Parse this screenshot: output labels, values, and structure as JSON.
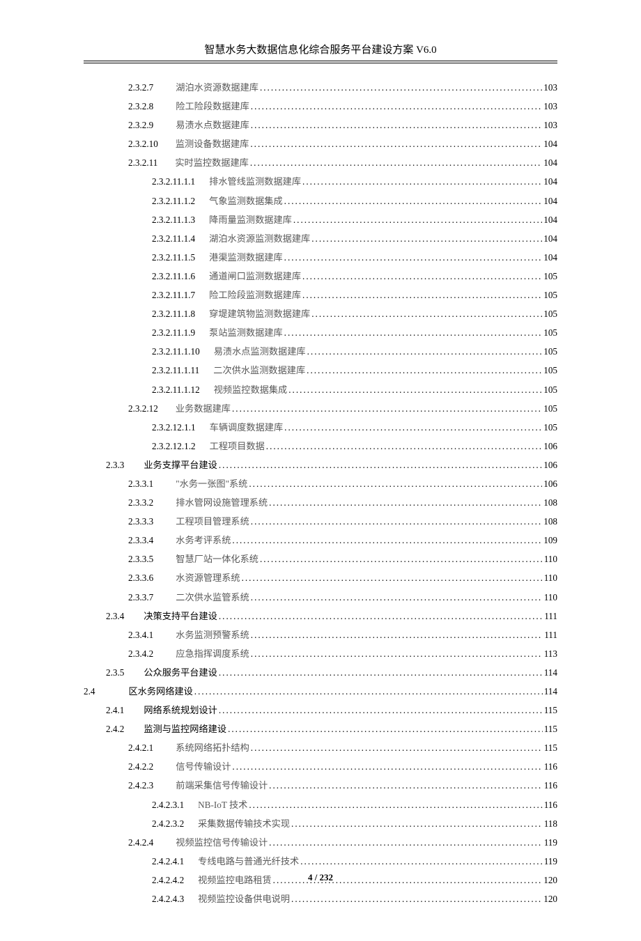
{
  "header": {
    "title": "智慧水务大数据信息化综合服务平台建设方案 V6.0"
  },
  "footer": {
    "text": "4 / 232"
  },
  "toc": [
    {
      "indent": "ind-4",
      "num": "2.3.2.7",
      "title": "湖泊水资源数据建库",
      "page": "103",
      "gap": 32
    },
    {
      "indent": "ind-4",
      "num": "2.3.2.8",
      "title": "险工险段数据建库",
      "page": "103",
      "gap": 32
    },
    {
      "indent": "ind-4",
      "num": "2.3.2.9",
      "title": "易渍水点数据建库",
      "page": "103",
      "gap": 32
    },
    {
      "indent": "ind-4",
      "num": "2.3.2.10",
      "title": "监测设备数据建库",
      "page": "104",
      "gap": 25
    },
    {
      "indent": "ind-4",
      "num": "2.3.2.11",
      "title": "实时监控数据建库",
      "page": "104",
      "gap": 25
    },
    {
      "indent": "ind-5",
      "num": "2.3.2.11.1.1",
      "title": "排水管线监测数据建库",
      "page": "104",
      "gap": 20
    },
    {
      "indent": "ind-5",
      "num": "2.3.2.11.1.2",
      "title": "气象监测数据集成",
      "page": "104",
      "gap": 20
    },
    {
      "indent": "ind-5",
      "num": "2.3.2.11.1.3",
      "title": "降雨量监测数据建库",
      "page": "104",
      "gap": 20
    },
    {
      "indent": "ind-5",
      "num": "2.3.2.11.1.4",
      "title": "湖泊水资源监测数据建库",
      "page": "104",
      "gap": 20
    },
    {
      "indent": "ind-5",
      "num": "2.3.2.11.1.5",
      "title": "港渠监测数据建库",
      "page": "104",
      "gap": 20
    },
    {
      "indent": "ind-5",
      "num": "2.3.2.11.1.6",
      "title": "通道闸口监测数据建库",
      "page": "105",
      "gap": 20
    },
    {
      "indent": "ind-5",
      "num": "2.3.2.11.1.7",
      "title": "险工险段监测数据建库",
      "page": "105",
      "gap": 20
    },
    {
      "indent": "ind-5",
      "num": "2.3.2.11.1.8",
      "title": "穿堤建筑物监测数据建库",
      "page": "105",
      "gap": 20
    },
    {
      "indent": "ind-5",
      "num": "2.3.2.11.1.9",
      "title": "泵站监测数据建库",
      "page": "105",
      "gap": 20
    },
    {
      "indent": "ind-5",
      "num": "2.3.2.11.1.10",
      "title": "易渍水点监测数据建库",
      "page": "105",
      "gap": 20
    },
    {
      "indent": "ind-5",
      "num": "2.3.2.11.1.11",
      "title": "二次供水监测数据建库",
      "page": "105",
      "gap": 20
    },
    {
      "indent": "ind-5",
      "num": "2.3.2.11.1.12",
      "title": "视频监控数据集成",
      "page": "105",
      "gap": 20
    },
    {
      "indent": "ind-4",
      "num": "2.3.2.12",
      "title": "业务数据建库",
      "page": "105",
      "gap": 25
    },
    {
      "indent": "ind-5",
      "num": "2.3.2.12.1.1",
      "title": "车辆调度数据建库",
      "page": "105",
      "gap": 20
    },
    {
      "indent": "ind-5",
      "num": "2.3.2.12.1.2",
      "title": "工程项目数据",
      "page": "106",
      "gap": 20
    },
    {
      "indent": "ind-3",
      "num": "2.3.3",
      "title": "业务支撑平台建设",
      "page": "106",
      "gap": 28,
      "dark": true
    },
    {
      "indent": "ind-4",
      "num": "2.3.3.1",
      "title": "\"水务一张图\"系统",
      "page": "106",
      "gap": 32
    },
    {
      "indent": "ind-4",
      "num": "2.3.3.2",
      "title": "排水管网设施管理系统",
      "page": "108",
      "gap": 32
    },
    {
      "indent": "ind-4",
      "num": "2.3.3.3",
      "title": "工程项目管理系统",
      "page": "108",
      "gap": 32
    },
    {
      "indent": "ind-4",
      "num": "2.3.3.4",
      "title": "水务考评系统",
      "page": "109",
      "gap": 32
    },
    {
      "indent": "ind-4",
      "num": "2.3.3.5",
      "title": "智慧厂站一体化系统",
      "page": "110",
      "gap": 32
    },
    {
      "indent": "ind-4",
      "num": "2.3.3.6",
      "title": "水资源管理系统",
      "page": "110",
      "gap": 32
    },
    {
      "indent": "ind-4",
      "num": "2.3.3.7",
      "title": "二次供水监管系统",
      "page": "110",
      "gap": 32
    },
    {
      "indent": "ind-3",
      "num": "2.3.4",
      "title": "决策支持平台建设",
      "page": "111",
      "gap": 28,
      "dark": true
    },
    {
      "indent": "ind-4",
      "num": "2.3.4.1",
      "title": "水务监测预警系统",
      "page": "111",
      "gap": 32
    },
    {
      "indent": "ind-4",
      "num": "2.3.4.2",
      "title": "应急指挥调度系统",
      "page": "113",
      "gap": 32
    },
    {
      "indent": "ind-3",
      "num": "2.3.5",
      "title": "公众服务平台建设",
      "page": "114",
      "gap": 28,
      "dark": true
    },
    {
      "indent": "ind-2",
      "num": "2.4",
      "title": "区水务网络建设",
      "page": "114",
      "gap": 48,
      "dark": true
    },
    {
      "indent": "ind-3",
      "num": "2.4.1",
      "title": "网络系统规划设计",
      "page": "115",
      "gap": 28,
      "dark": true
    },
    {
      "indent": "ind-3",
      "num": "2.4.2",
      "title": "监测与监控网络建设",
      "page": "115",
      "gap": 28,
      "dark": true
    },
    {
      "indent": "ind-4",
      "num": "2.4.2.1",
      "title": "系统网络拓扑结构",
      "page": "115",
      "gap": 32
    },
    {
      "indent": "ind-4",
      "num": "2.4.2.2",
      "title": "信号传输设计",
      "page": "116",
      "gap": 32
    },
    {
      "indent": "ind-4",
      "num": "2.4.2.3",
      "title": "前端采集信号传输设计",
      "page": "116",
      "gap": 32
    },
    {
      "indent": "ind-5",
      "num": "2.4.2.3.1",
      "title": "NB-IoT 技术",
      "page": "116",
      "gap": 20
    },
    {
      "indent": "ind-5",
      "num": "2.4.2.3.2",
      "title": "采集数据传输技术实现",
      "page": "118",
      "gap": 20
    },
    {
      "indent": "ind-4",
      "num": "2.4.2.4",
      "title": "视频监控信号传输设计",
      "page": "119",
      "gap": 32
    },
    {
      "indent": "ind-5",
      "num": "2.4.2.4.1",
      "title": "专线电路与普通光纤技术",
      "page": "119",
      "gap": 20
    },
    {
      "indent": "ind-5",
      "num": "2.4.2.4.2",
      "title": "视频监控电路租赁",
      "page": "120",
      "gap": 20
    },
    {
      "indent": "ind-5",
      "num": "2.4.2.4.3",
      "title": "视频监控设备供电说明",
      "page": "120",
      "gap": 20
    }
  ]
}
